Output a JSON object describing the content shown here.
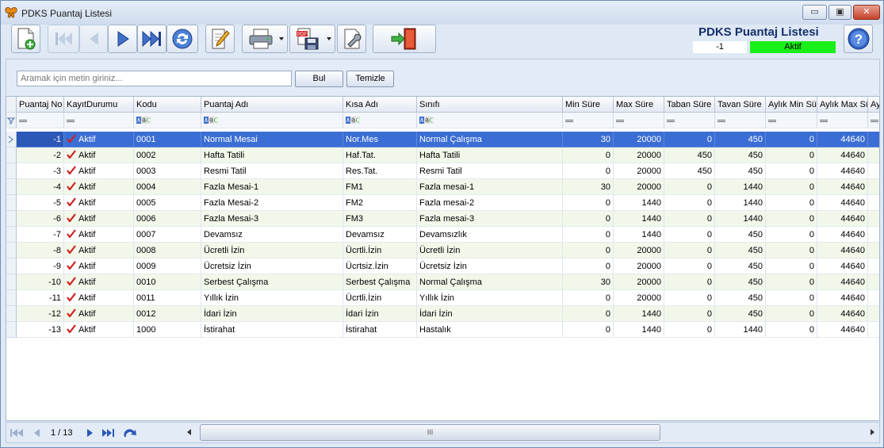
{
  "window": {
    "title": "PDKS Puantaj Listesi",
    "minimize": "▭",
    "maximize": "▣",
    "close": "✕"
  },
  "header": {
    "title": "PDKS Puantaj Listesi",
    "value": "-1",
    "status": "Aktif"
  },
  "search": {
    "placeholder": "Aramak için metin giriniz...",
    "find_label": "Bul",
    "clear_label": "Temizle"
  },
  "toolbar": {
    "icons": [
      "new-document-icon",
      "first-record-icon",
      "previous-record-icon",
      "next-record-icon",
      "last-record-icon",
      "refresh-icon",
      "edit-icon",
      "print-icon",
      "export-pdf-icon",
      "settings-icon",
      "exit-icon",
      "help-icon"
    ]
  },
  "grid": {
    "columns": [
      "Puantaj No",
      "KayıtDurumu",
      "Kodu",
      "Puantaj Adı",
      "Kısa Adı",
      "Sınıfı",
      "Min Süre",
      "Max Süre",
      "Taban Süre",
      "Tavan Süre",
      "Aylık Min Sür",
      "Aylık Max Sü",
      "Ay"
    ],
    "rows": [
      [
        "-1",
        "Aktif",
        "0001",
        "Normal Mesai",
        "Nor.Mes",
        "Normal Çalışma",
        "30",
        "20000",
        "0",
        "450",
        "0",
        "44640"
      ],
      [
        "-2",
        "Aktif",
        "0002",
        "Hafta Tatili",
        "Haf.Tat.",
        "Hafta Tatili",
        "0",
        "20000",
        "450",
        "450",
        "0",
        "44640"
      ],
      [
        "-3",
        "Aktif",
        "0003",
        "Resmi Tatil",
        "Res.Tat.",
        "Resmi Tatil",
        "0",
        "20000",
        "450",
        "450",
        "0",
        "44640"
      ],
      [
        "-4",
        "Aktif",
        "0004",
        "Fazla Mesai-1",
        "FM1",
        "Fazla mesai-1",
        "30",
        "20000",
        "0",
        "1440",
        "0",
        "44640"
      ],
      [
        "-5",
        "Aktif",
        "0005",
        "Fazla Mesai-2",
        "FM2",
        "Fazla mesai-2",
        "0",
        "1440",
        "0",
        "1440",
        "0",
        "44640"
      ],
      [
        "-6",
        "Aktif",
        "0006",
        "Fazla Mesai-3",
        "FM3",
        "Fazla mesai-3",
        "0",
        "1440",
        "0",
        "1440",
        "0",
        "44640"
      ],
      [
        "-7",
        "Aktif",
        "0007",
        "Devamsız",
        "Devamsız",
        "Devamsızlık",
        "0",
        "1440",
        "0",
        "450",
        "0",
        "44640"
      ],
      [
        "-8",
        "Aktif",
        "0008",
        "Ücretli İzin",
        "Ücrtli.İzin",
        "Ücretli İzin",
        "0",
        "20000",
        "0",
        "450",
        "0",
        "44640"
      ],
      [
        "-9",
        "Aktif",
        "0009",
        "Ücretsiz İzin",
        "Ücrtsiz.İzin",
        "Ücretsiz İzin",
        "0",
        "20000",
        "0",
        "450",
        "0",
        "44640"
      ],
      [
        "-10",
        "Aktif",
        "0010",
        "Serbest Çalışma",
        "Serbest Çalışma",
        "Normal Çalışma",
        "30",
        "20000",
        "0",
        "450",
        "0",
        "44640"
      ],
      [
        "-11",
        "Aktif",
        "0011",
        "Yıllık İzin",
        "Ücrtli.İzin",
        "Yıllık İzin",
        "0",
        "20000",
        "0",
        "450",
        "0",
        "44640"
      ],
      [
        "-12",
        "Aktif",
        "0012",
        "İdari İzin",
        "İdari İzin",
        "İdari İzin",
        "0",
        "1440",
        "0",
        "450",
        "0",
        "44640"
      ],
      [
        "-13",
        "Aktif",
        "1000",
        "İstirahat",
        "İstirahat",
        "Hastalık",
        "0",
        "1440",
        "0",
        "1440",
        "0",
        "44640"
      ]
    ],
    "selected_row": 0
  },
  "pager": {
    "info": "1 / 13",
    "scroll_grip": "III"
  },
  "colors": {
    "selection": "#3b6ed4",
    "status_active": "#18ef18",
    "alt_row": "#f1f8ea",
    "check": "#d22020"
  }
}
